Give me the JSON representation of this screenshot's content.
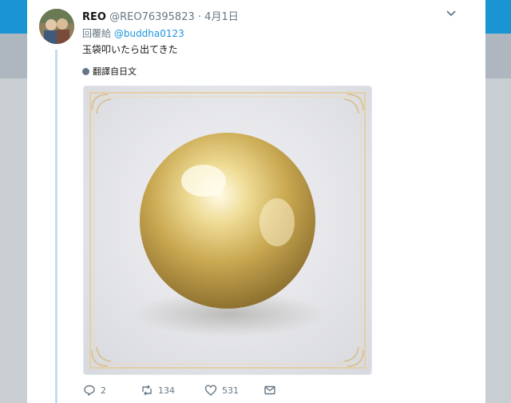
{
  "tweet": {
    "display_name": "REO",
    "handle": "@REO76395823",
    "separator": "·",
    "date": "4月1日",
    "reply_prefix": "回覆給",
    "reply_to": "@buddha0123",
    "text": "玉袋叩いたら出てきた",
    "translate_label": "翻譯自日文"
  },
  "actions": {
    "reply_count": "2",
    "retweet_count": "134",
    "like_count": "531"
  },
  "colors": {
    "accent": "#1b95e0",
    "muted_text": "#657786",
    "thread_line": "#c5dcef"
  },
  "icons": [
    "chevron-down-icon",
    "globe-icon",
    "reply-icon",
    "retweet-icon",
    "like-icon",
    "message-icon"
  ]
}
